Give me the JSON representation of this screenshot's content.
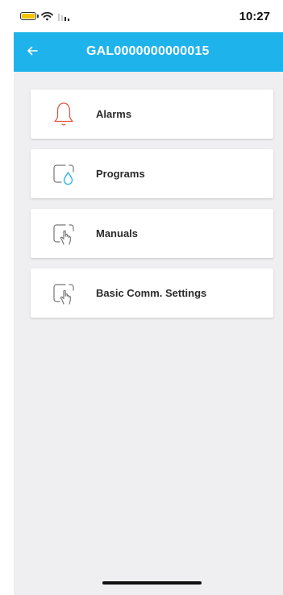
{
  "status_bar": {
    "time": "10:27",
    "battery_icon": "battery-icon",
    "wifi_icon": "wifi-icon",
    "signal_icon": "signal-icon",
    "battery_color": "#f2c500"
  },
  "header": {
    "title": "GAL0000000000015",
    "back_icon": "arrow-left-icon",
    "background_color": "#1fb3ec"
  },
  "menu": {
    "items": [
      {
        "label": "Alarms",
        "icon": "bell-icon",
        "icon_color": "#e0533f"
      },
      {
        "label": "Programs",
        "icon": "water-drop-icon",
        "icon_color": "#1fb3ec"
      },
      {
        "label": "Manuals",
        "icon": "hand-pointer-icon",
        "icon_color": "#777777"
      },
      {
        "label": "Basic Comm. Settings",
        "icon": "hand-pointer-icon",
        "icon_color": "#777777"
      }
    ]
  }
}
